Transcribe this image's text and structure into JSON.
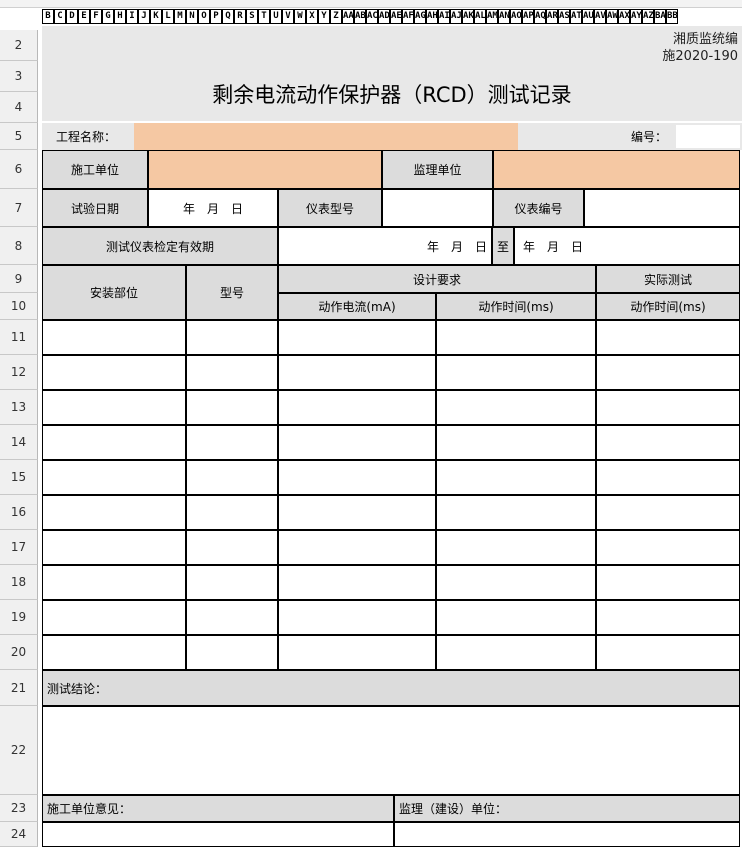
{
  "columns": [
    "B",
    "C",
    "D",
    "E",
    "F",
    "G",
    "H",
    "I",
    "J",
    "K",
    "L",
    "M",
    "N",
    "O",
    "P",
    "Q",
    "R",
    "S",
    "T",
    "U",
    "V",
    "W",
    "X",
    "Y",
    "Z",
    "AA",
    "AB",
    "AC",
    "AD",
    "AE",
    "AF",
    "AG",
    "AH",
    "AI",
    "AJ",
    "AK",
    "AL",
    "AM",
    "AN",
    "AO",
    "AP",
    "AQ",
    "AR",
    "AS",
    "AT",
    "AU",
    "AV",
    "AW",
    "AX",
    "AY",
    "AZ",
    "BA",
    "BB"
  ],
  "rows": [
    "2",
    "3",
    "4",
    "5",
    "6",
    "7",
    "8",
    "9",
    "10",
    "11",
    "12",
    "13",
    "14",
    "15",
    "16",
    "17",
    "18",
    "19",
    "20",
    "21",
    "22",
    "23",
    "24"
  ],
  "doc": {
    "ref_line1": "湘质监统编",
    "ref_line2": "施2020-190",
    "title": "剩余电流动作保护器（RCD）测试记录",
    "project_label": "工程名称：",
    "serial_label": "编号："
  },
  "form": {
    "construction_unit": "施工单位",
    "supervision_unit": "监理单位",
    "test_date": "试验日期",
    "date_value": "年　月　日",
    "meter_model": "仪表型号",
    "meter_no": "仪表编号",
    "calibration_validity": "测试仪表检定有效期",
    "validity_from": "年　月　日",
    "validity_to_word": "至",
    "validity_to": "年　月　日",
    "install_location": "安装部位",
    "model": "型号",
    "design_req": "设计要求",
    "actual_test": "实际测试",
    "op_current": "动作电流(mA)",
    "op_time": "动作时间(ms)",
    "op_time_actual": "动作时间(ms)",
    "conclusion": "测试结论：",
    "construction_opinion": "施工单位意见：",
    "supervision_unit_opinion": "监理（建设）单位："
  },
  "colors": {
    "gray": "#dcdcdc",
    "peach": "#f5c8a3"
  }
}
